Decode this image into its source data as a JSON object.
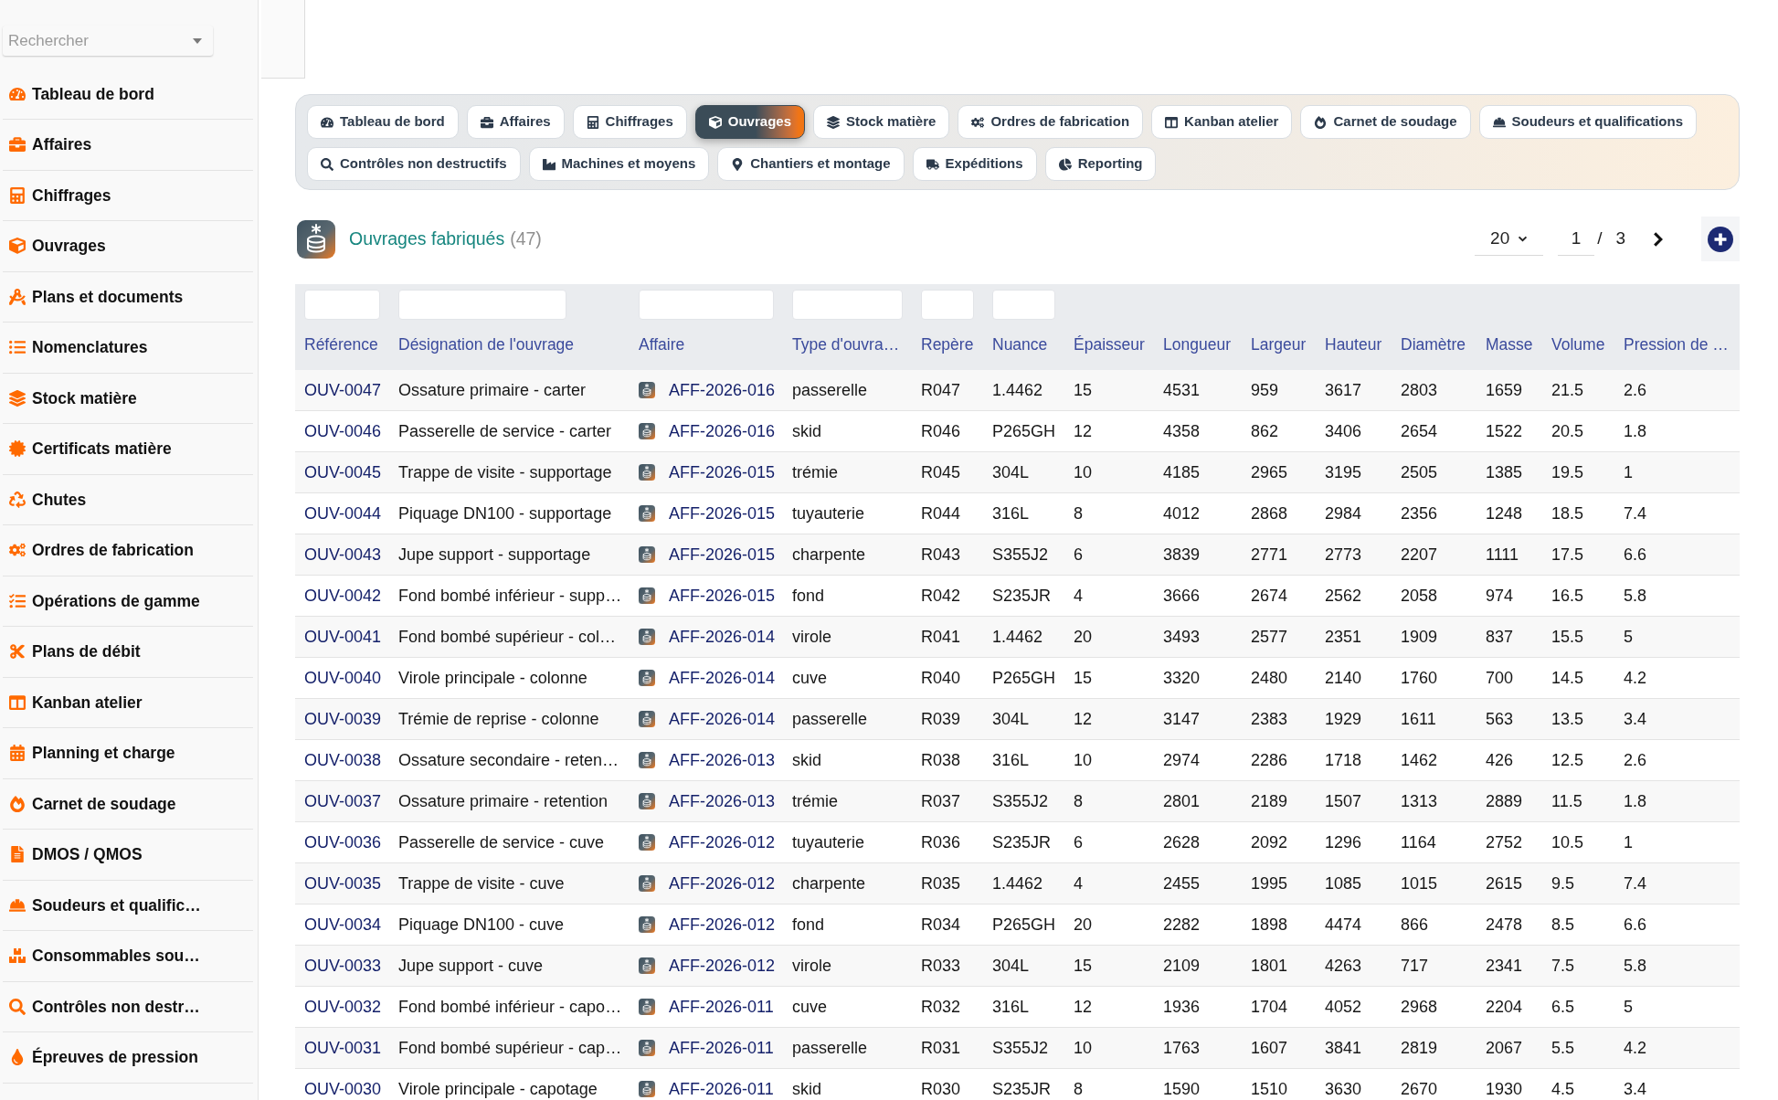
{
  "sidebar": {
    "search": {
      "placeholder": "Rechercher"
    },
    "items": [
      "Tableau de bord",
      "Affaires",
      "Chiffrages",
      "Ouvrages",
      "Plans et documents",
      "Nomenclatures",
      "Stock matière",
      "Certificats matière",
      "Chutes",
      "Ordres de fabrication",
      "Opérations de gamme",
      "Plans de débit",
      "Kanban atelier",
      "Planning et charge",
      "Carnet de soudage",
      "DMOS / QMOS",
      "Soudeurs et qualific…",
      "Consommables sou…",
      "Contrôles non destr…",
      "Épreuves de pression"
    ]
  },
  "tabs": [
    {
      "label": "Tableau de bord",
      "selected": false
    },
    {
      "label": "Affaires",
      "selected": false
    },
    {
      "label": "Chiffrages",
      "selected": false
    },
    {
      "label": "Ouvrages",
      "selected": true
    },
    {
      "label": "Stock matière",
      "selected": false
    },
    {
      "label": "Ordres de fabrication",
      "selected": false
    },
    {
      "label": "Kanban atelier",
      "selected": false
    },
    {
      "label": "Carnet de soudage",
      "selected": false
    },
    {
      "label": "Soudeurs et qualifications",
      "selected": false
    },
    {
      "label": "Contrôles non destructifs",
      "selected": false
    },
    {
      "label": "Machines et moyens",
      "selected": false
    },
    {
      "label": "Chantiers et montage",
      "selected": false
    },
    {
      "label": "Expéditions",
      "selected": false
    },
    {
      "label": "Reporting",
      "selected": false
    }
  ],
  "section": {
    "title": "Ouvrages fabriqués",
    "count": "(47)"
  },
  "pagination": {
    "page_size": "20",
    "page": "1",
    "separator": "/",
    "total_pages": "3"
  },
  "table": {
    "columns": [
      {
        "label": "Référence",
        "kind": "link",
        "filter": true
      },
      {
        "label": "Désignation de l'ouvrage",
        "kind": "text",
        "filter": true
      },
      {
        "label": "Affaire",
        "kind": "affaire",
        "filter": true
      },
      {
        "label": "Type d'ouvra…",
        "kind": "text",
        "filter": true
      },
      {
        "label": "Repère",
        "kind": "text",
        "filter": true
      },
      {
        "label": "Nuance",
        "kind": "text",
        "filter": true
      },
      {
        "label": "Épaisseur",
        "kind": "text",
        "filter": false
      },
      {
        "label": "Longueur",
        "kind": "text",
        "filter": false
      },
      {
        "label": "Largeur",
        "kind": "text",
        "filter": false
      },
      {
        "label": "Hauteur",
        "kind": "text",
        "filter": false
      },
      {
        "label": "Diamètre",
        "kind": "text",
        "filter": false
      },
      {
        "label": "Masse",
        "kind": "text",
        "filter": false
      },
      {
        "label": "Volume",
        "kind": "text",
        "filter": false
      },
      {
        "label": "Pression de …",
        "kind": "text",
        "filter": false
      }
    ],
    "rows": [
      [
        "OUV-0047",
        "Ossature primaire - carter",
        "AFF-2026-016",
        "passerelle",
        "R047",
        "1.4462",
        "15",
        "4531",
        "959",
        "3617",
        "2803",
        "1659",
        "21.5",
        "2.6"
      ],
      [
        "OUV-0046",
        "Passerelle de service - carter",
        "AFF-2026-016",
        "skid",
        "R046",
        "P265GH",
        "12",
        "4358",
        "862",
        "3406",
        "2654",
        "1522",
        "20.5",
        "1.8"
      ],
      [
        "OUV-0045",
        "Trappe de visite - supportage",
        "AFF-2026-015",
        "trémie",
        "R045",
        "304L",
        "10",
        "4185",
        "2965",
        "3195",
        "2505",
        "1385",
        "19.5",
        "1"
      ],
      [
        "OUV-0044",
        "Piquage DN100 - supportage",
        "AFF-2026-015",
        "tuyauterie",
        "R044",
        "316L",
        "8",
        "4012",
        "2868",
        "2984",
        "2356",
        "1248",
        "18.5",
        "7.4"
      ],
      [
        "OUV-0043",
        "Jupe support - supportage",
        "AFF-2026-015",
        "charpente",
        "R043",
        "S355J2",
        "6",
        "3839",
        "2771",
        "2773",
        "2207",
        "1111",
        "17.5",
        "6.6"
      ],
      [
        "OUV-0042",
        "Fond bombé inférieur - supp…",
        "AFF-2026-015",
        "fond",
        "R042",
        "S235JR",
        "4",
        "3666",
        "2674",
        "2562",
        "2058",
        "974",
        "16.5",
        "5.8"
      ],
      [
        "OUV-0041",
        "Fond bombé supérieur - col…",
        "AFF-2026-014",
        "virole",
        "R041",
        "1.4462",
        "20",
        "3493",
        "2577",
        "2351",
        "1909",
        "837",
        "15.5",
        "5"
      ],
      [
        "OUV-0040",
        "Virole principale - colonne",
        "AFF-2026-014",
        "cuve",
        "R040",
        "P265GH",
        "15",
        "3320",
        "2480",
        "2140",
        "1760",
        "700",
        "14.5",
        "4.2"
      ],
      [
        "OUV-0039",
        "Trémie de reprise - colonne",
        "AFF-2026-014",
        "passerelle",
        "R039",
        "304L",
        "12",
        "3147",
        "2383",
        "1929",
        "1611",
        "563",
        "13.5",
        "3.4"
      ],
      [
        "OUV-0038",
        "Ossature secondaire - reten…",
        "AFF-2026-013",
        "skid",
        "R038",
        "316L",
        "10",
        "2974",
        "2286",
        "1718",
        "1462",
        "426",
        "12.5",
        "2.6"
      ],
      [
        "OUV-0037",
        "Ossature primaire - retention",
        "AFF-2026-013",
        "trémie",
        "R037",
        "S355J2",
        "8",
        "2801",
        "2189",
        "1507",
        "1313",
        "2889",
        "11.5",
        "1.8"
      ],
      [
        "OUV-0036",
        "Passerelle de service - cuve",
        "AFF-2026-012",
        "tuyauterie",
        "R036",
        "S235JR",
        "6",
        "2628",
        "2092",
        "1296",
        "1164",
        "2752",
        "10.5",
        "1"
      ],
      [
        "OUV-0035",
        "Trappe de visite - cuve",
        "AFF-2026-012",
        "charpente",
        "R035",
        "1.4462",
        "4",
        "2455",
        "1995",
        "1085",
        "1015",
        "2615",
        "9.5",
        "7.4"
      ],
      [
        "OUV-0034",
        "Piquage DN100 - cuve",
        "AFF-2026-012",
        "fond",
        "R034",
        "P265GH",
        "20",
        "2282",
        "1898",
        "4474",
        "866",
        "2478",
        "8.5",
        "6.6"
      ],
      [
        "OUV-0033",
        "Jupe support - cuve",
        "AFF-2026-012",
        "virole",
        "R033",
        "304L",
        "15",
        "2109",
        "1801",
        "4263",
        "717",
        "2341",
        "7.5",
        "5.8"
      ],
      [
        "OUV-0032",
        "Fond bombé inférieur - capo…",
        "AFF-2026-011",
        "cuve",
        "R032",
        "316L",
        "12",
        "1936",
        "1704",
        "4052",
        "2968",
        "2204",
        "6.5",
        "5"
      ],
      [
        "OUV-0031",
        "Fond bombé supérieur - cap…",
        "AFF-2026-011",
        "passerelle",
        "R031",
        "S355J2",
        "10",
        "1763",
        "1607",
        "3841",
        "2819",
        "2067",
        "5.5",
        "4.2"
      ],
      [
        "OUV-0030",
        "Virole principale - capotage",
        "AFF-2026-011",
        "skid",
        "R030",
        "S235JR",
        "8",
        "1590",
        "1510",
        "3630",
        "2670",
        "1930",
        "4.5",
        "3.4"
      ]
    ]
  }
}
